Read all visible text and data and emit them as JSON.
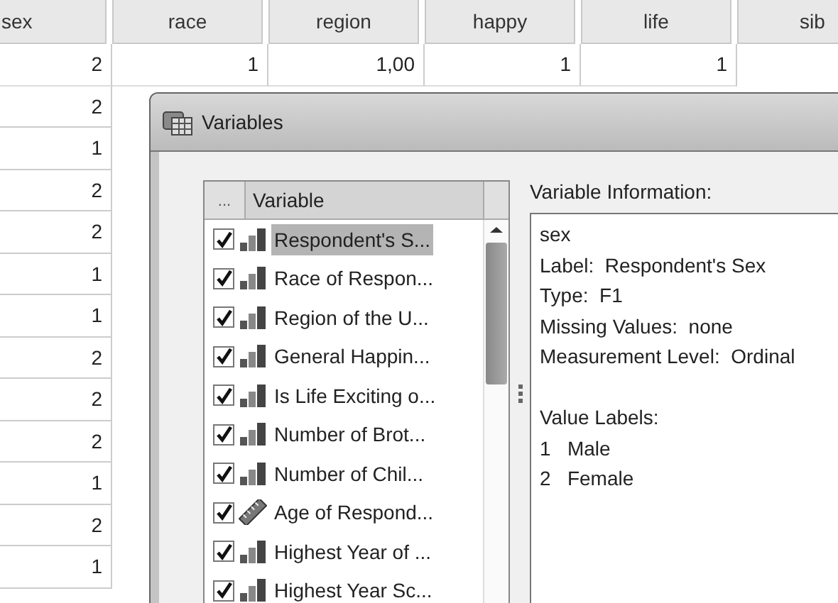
{
  "grid": {
    "columns": [
      "sex",
      "race",
      "region",
      "happy",
      "life",
      "sib"
    ],
    "rows": [
      [
        "2",
        "1",
        "1,00",
        "1",
        "1"
      ],
      [
        "2"
      ],
      [
        "1"
      ],
      [
        "2"
      ],
      [
        "2"
      ],
      [
        "1"
      ],
      [
        "1"
      ],
      [
        "2"
      ],
      [
        "2"
      ],
      [
        "2"
      ],
      [
        "1"
      ],
      [
        "2"
      ],
      [
        "1"
      ]
    ]
  },
  "dialog": {
    "title": "Variables",
    "list": {
      "columns": [
        "...",
        "Variable"
      ],
      "items": [
        {
          "label": "Respondent's S...",
          "kind": "ordinal",
          "checked": true,
          "selected": true
        },
        {
          "label": "Race of Respon...",
          "kind": "ordinal",
          "checked": true,
          "selected": false
        },
        {
          "label": "Region of the U...",
          "kind": "ordinal",
          "checked": true,
          "selected": false
        },
        {
          "label": "General Happin...",
          "kind": "ordinal",
          "checked": true,
          "selected": false
        },
        {
          "label": "Is Life Exciting o...",
          "kind": "ordinal",
          "checked": true,
          "selected": false
        },
        {
          "label": "Number of Brot...",
          "kind": "ordinal",
          "checked": true,
          "selected": false
        },
        {
          "label": "Number of Chil...",
          "kind": "ordinal",
          "checked": true,
          "selected": false
        },
        {
          "label": "Age of Respond...",
          "kind": "scale",
          "checked": true,
          "selected": false
        },
        {
          "label": "Highest Year of ...",
          "kind": "ordinal",
          "checked": true,
          "selected": false
        },
        {
          "label": "Highest Year Sc...",
          "kind": "ordinal",
          "checked": true,
          "selected": false
        }
      ]
    },
    "info": {
      "heading": "Variable Information:",
      "lines": [
        "sex",
        "Label:  Respondent's Sex",
        "Type:  F1",
        "Missing Values:  none",
        "Measurement Level:  Ordinal"
      ],
      "value_heading": "Value Labels:",
      "value_labels": [
        "1   Male",
        "2   Female"
      ]
    }
  }
}
